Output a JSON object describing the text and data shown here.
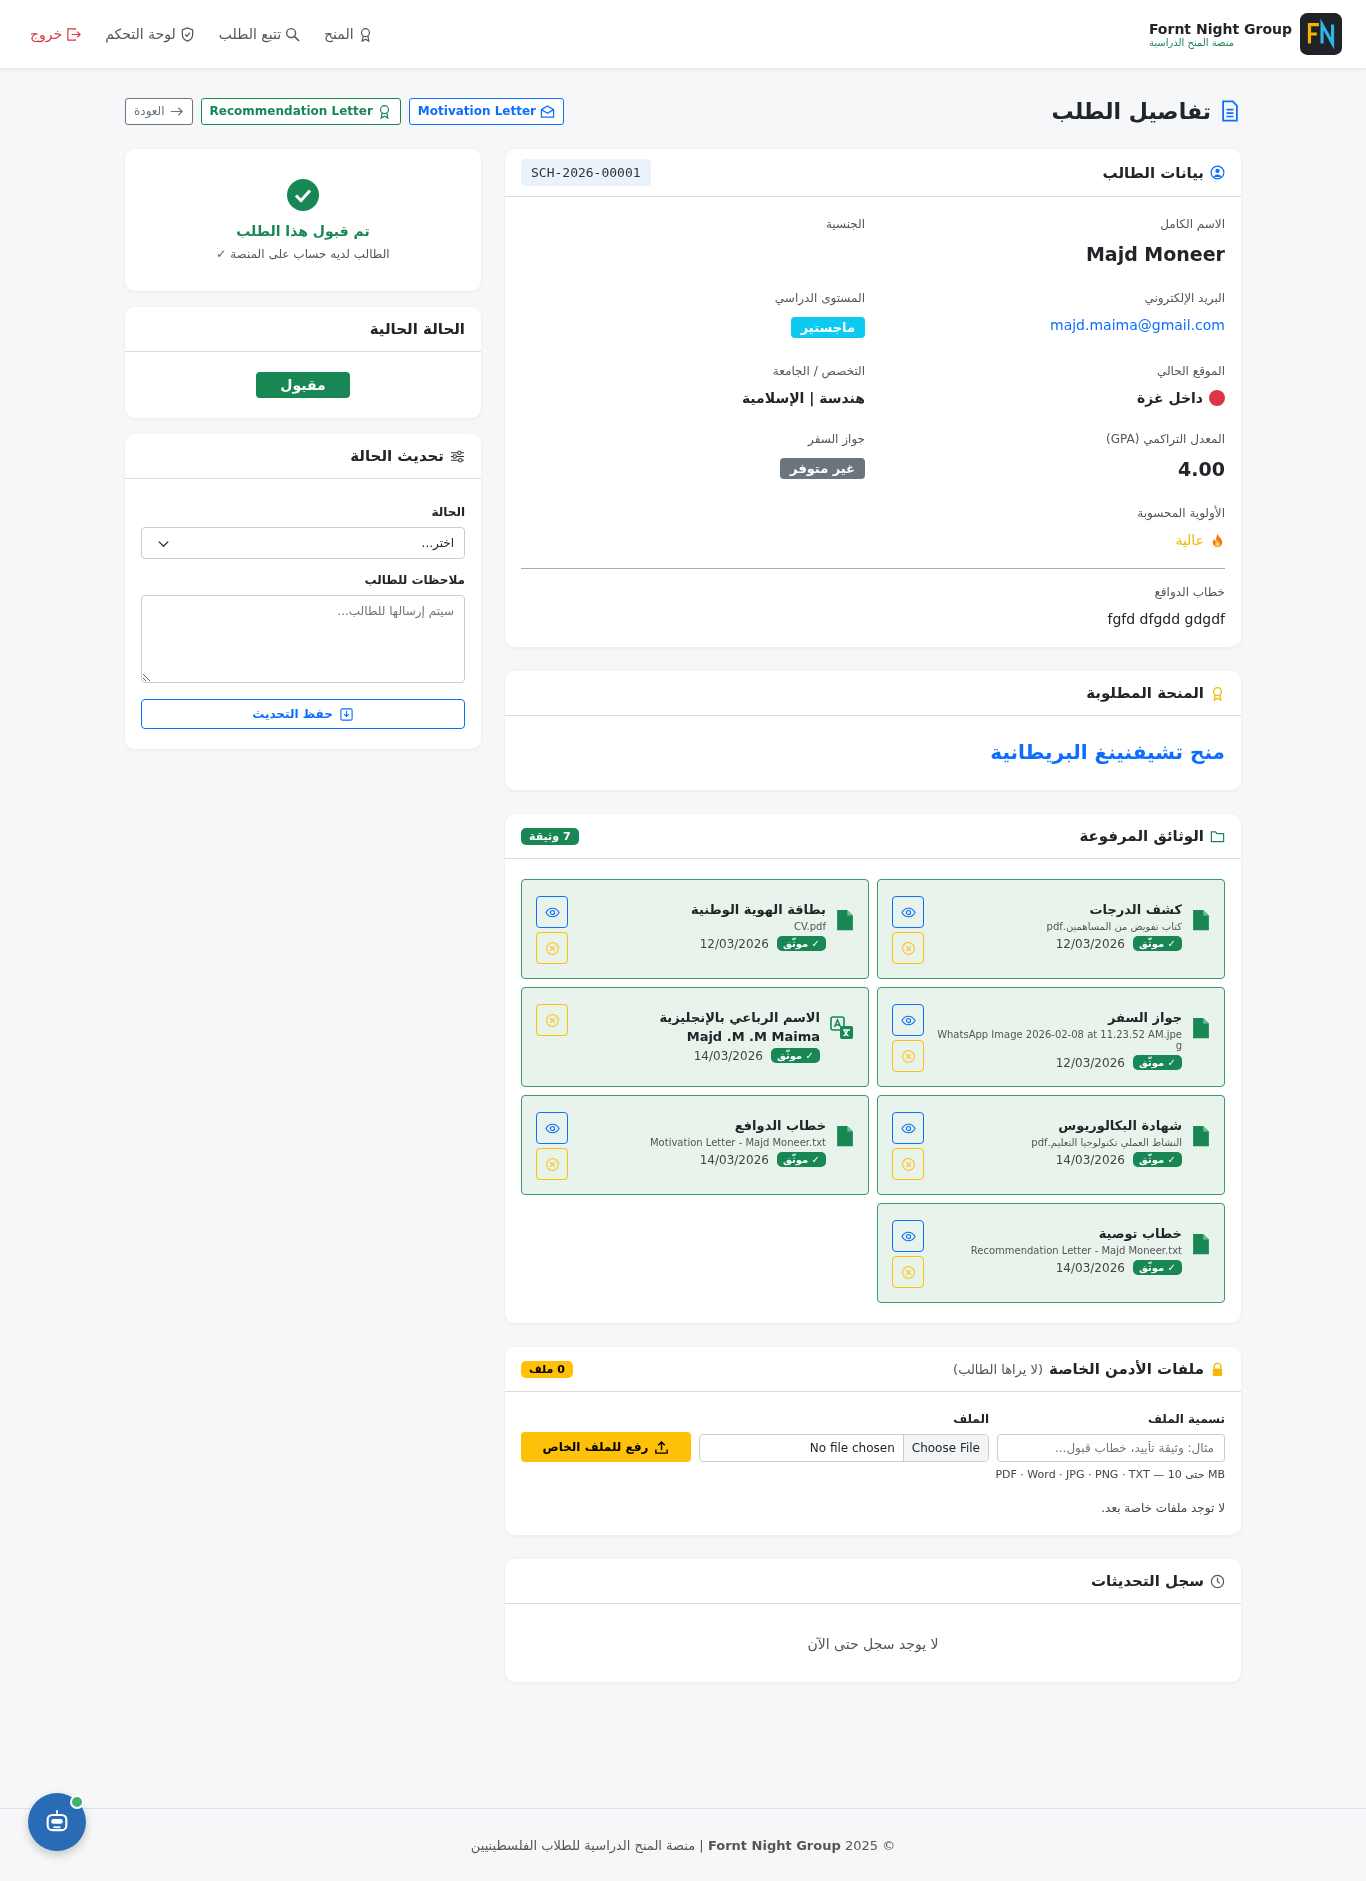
{
  "header": {
    "brand": "Fornt Night Group",
    "tagline": "منصة المنح الدراسية",
    "nav": [
      {
        "kind": "award",
        "label": "المنح"
      },
      {
        "kind": "search",
        "label": "تتبع الطلب"
      },
      {
        "kind": "shield",
        "label": "لوحة التحكم"
      },
      {
        "kind": "logout",
        "label": "خروج"
      }
    ]
  },
  "page": {
    "title": "تفاصيل الطلب",
    "actions": [
      {
        "kind": "motivation",
        "label": "Motivation Letter"
      },
      {
        "kind": "recommendation",
        "label": "Recommendation Letter"
      },
      {
        "kind": "back",
        "label": "العودة"
      }
    ]
  },
  "student": {
    "title": "بيانات الطالب",
    "code": "SCH-2026-00001",
    "fields": [
      {
        "kind": "large",
        "label": "الاسم الكامل",
        "value": "Majd Moneer"
      },
      {
        "kind": "empty",
        "label": "الجنسية"
      },
      {
        "kind": "link",
        "label": "البريد الإلكتروني",
        "value": "majd.maima@gmail.com"
      },
      {
        "kind": "badge",
        "label": "المستوى الدراسي",
        "value": "ماجستير",
        "color": "#0dcaf0"
      },
      {
        "kind": "location",
        "label": "الموقع الحالي",
        "value": "داخل غزة",
        "color": "#dc3545"
      },
      {
        "kind": "text",
        "label": "التخصص / الجامعة",
        "value": "هندسة | الإسلامية"
      },
      {
        "kind": "large",
        "label": "المعدل التراكمي (GPA)",
        "value": "4.00"
      },
      {
        "kind": "badge",
        "label": "جواز السفر",
        "value": "غير متوفر",
        "color": "#6c757d"
      },
      {
        "kind": "priority",
        "label": "الأولوية المحسوبة",
        "value": "عالية"
      }
    ],
    "motivation": {
      "label": "خطاب الدوافع",
      "value": "fgfd dfgdd gdgdf"
    }
  },
  "scholarship": {
    "title": "المنحة المطلوبة",
    "name": "منح تشيفنينغ البريطانية"
  },
  "documents": {
    "title": "الوثائق المرفوعة",
    "count": "7 وثيقة",
    "items": [
      {
        "kind": "file",
        "title": "كشف الدرجات",
        "file": "كتاب تفويض من المساهمين.pdf",
        "date": "12/03/2026",
        "badge": "✓ موثّق",
        "viewable": true
      },
      {
        "kind": "file",
        "title": "بطاقة الهوية الوطنية",
        "file": "CV.pdf",
        "date": "12/03/2026",
        "badge": "✓ موثّق",
        "viewable": true
      },
      {
        "kind": "file",
        "title": "جواز السفر",
        "file": "WhatsApp Image 2026-02-08 at 11.23.52 AM.jpeg",
        "date": "12/03/2026",
        "badge": "✓ موثّق",
        "viewable": true
      },
      {
        "kind": "translation",
        "title": "الاسم الرباعي بالإنجليزية",
        "value": "Majd .M .M Maima",
        "date": "14/03/2026",
        "badge": "✓ موثّق",
        "viewable": false
      },
      {
        "kind": "file",
        "title": "شهادة البكالوريوس",
        "file": "النشاط العملي تكنولوجيا التعليم.pdf",
        "date": "14/03/2026",
        "badge": "✓ موثّق",
        "viewable": true
      },
      {
        "kind": "file",
        "title": "خطاب الدوافع",
        "file": "Motivation Letter - Majd Moneer.txt",
        "date": "14/03/2026",
        "badge": "✓ موثّق",
        "viewable": true
      },
      {
        "kind": "file",
        "title": "خطاب توصية",
        "file": "Recommendation Letter - Majd Moneer.txt",
        "date": "14/03/2026",
        "badge": "✓ موثّق",
        "viewable": true
      }
    ]
  },
  "admin_files": {
    "title": "ملفات الأدمن الخاصة",
    "note": "(لا يراها الطالب)",
    "count": "0 ملف",
    "name_label": "تسمية الملف",
    "name_placeholder": "مثال: وثيقة تأييد، خطاب قبول...",
    "file_label": "الملف",
    "choose": "Choose File",
    "no_file": "No file chosen",
    "upload": "رفع للملف الخاص",
    "hint": "PDF · Word · JPG · PNG · TXT — حتى 10 MB",
    "empty": "لا توجد ملفات خاصة بعد."
  },
  "log": {
    "title": "سجل التحديثات",
    "empty": "لا يوجد سجل حتى الآن"
  },
  "sidebar": {
    "accepted": {
      "title": "تم قبول هذا الطلب",
      "note": "الطالب لديه حساب على المنصة ✓"
    },
    "current": {
      "title": "الحالة الحالية",
      "status": "مقبول"
    },
    "update": {
      "title": "تحديث الحالة",
      "status_label": "الحالة",
      "status_value": "اختر...",
      "notes_label": "ملاحظات للطالب",
      "notes_placeholder": "سيتم إرسالها للطالب...",
      "save": "حفظ التحديث"
    }
  },
  "footer": {
    "text": "© 2025 **Fornt Night Group** | منصة المنح الدراسية للطلاب الفلسطينيين"
  }
}
